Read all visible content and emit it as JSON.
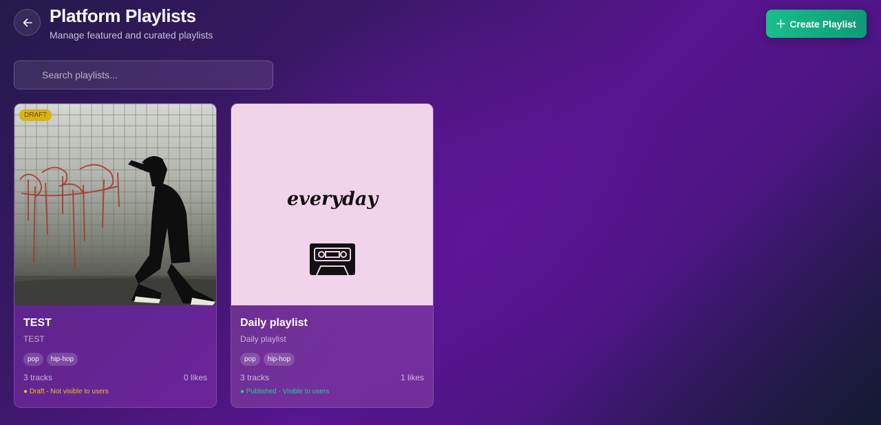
{
  "header": {
    "title": "Platform Playlists",
    "subtitle": "Manage featured and curated playlists",
    "back_icon": "arrow-left-icon",
    "create_label": "Create Playlist",
    "create_icon": "plus-icon"
  },
  "search": {
    "placeholder": "Search playlists...",
    "value": "",
    "icon": "search-icon"
  },
  "playlists": [
    {
      "title": "TEST",
      "description": "TEST",
      "badge": "DRAFT",
      "tags": [
        "pop",
        "hip-hop"
      ],
      "tracks": "3 tracks",
      "likes": "0 likes",
      "status": "● Draft - Not visible to users"
    },
    {
      "title": "Daily playlist",
      "description": "Daily playlist",
      "cover_text": "everyday",
      "tags": [
        "pop",
        "hip-hop"
      ],
      "tracks": "3 tracks",
      "likes": "1 likes",
      "status": "● Published - Visible to users"
    }
  ],
  "colors": {
    "accent": "#18bf8a",
    "draft": "#d9b315",
    "published": "#1fcf8c",
    "daily_cover_bg": "#f2d4ea"
  }
}
